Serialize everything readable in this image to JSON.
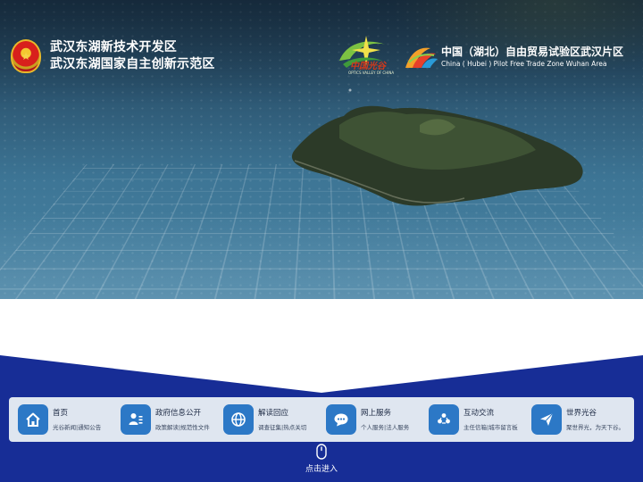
{
  "header": {
    "org_line1": "武汉东湖新技术开发区",
    "org_line2": "武汉东湖国家自主创新示范区",
    "optics_logo_text": "中国光谷",
    "optics_logo_sub": "OPTICS VALLEY OF CHINA",
    "ftz_title": "中国（湖北）自由贸易试验区武汉片区",
    "ftz_subtitle": "China ( Hubei ) Pilot Free Trade Zone Wuhan Area"
  },
  "nav": [
    {
      "title": "首页",
      "sub": "光谷新闻|通知公告",
      "icon": "home-icon"
    },
    {
      "title": "政府信息公开",
      "sub": "政策解读|规范性文件",
      "icon": "document-user-icon"
    },
    {
      "title": "解读回应",
      "sub": "调查征集|热点关切",
      "icon": "globe-icon"
    },
    {
      "title": "网上服务",
      "sub": "个人服务|法人服务",
      "icon": "chat-icon"
    },
    {
      "title": "互动交流",
      "sub": "主任信箱|城市留言板",
      "icon": "people-icon"
    },
    {
      "title": "世界光谷",
      "sub": "聚世界光，为天下谷。",
      "icon": "send-icon"
    }
  ],
  "enter": {
    "label": "点击进入",
    "icon": "mouse-icon"
  },
  "colors": {
    "accent_blue": "#2c78c6",
    "band_blue": "#172d96",
    "nav_bg": "#dfe6f0"
  }
}
